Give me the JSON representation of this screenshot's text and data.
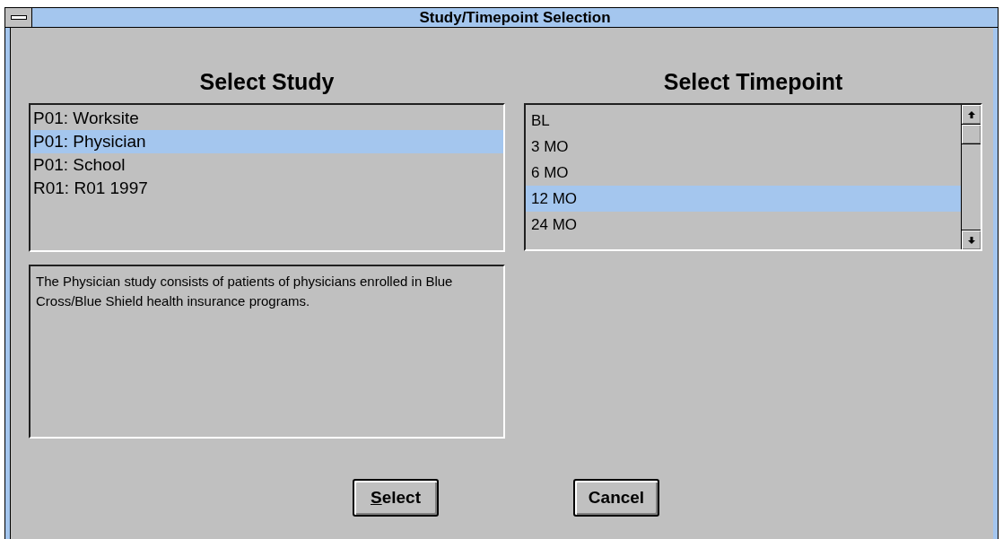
{
  "window": {
    "title": "Study/Timepoint Selection"
  },
  "study": {
    "heading": "Select Study",
    "items": [
      {
        "label": "P01: Worksite",
        "selected": false
      },
      {
        "label": "P01: Physician",
        "selected": true
      },
      {
        "label": "P01: School",
        "selected": false
      },
      {
        "label": "R01: R01 1997",
        "selected": false
      }
    ],
    "description": "The Physician study consists of patients of physicians enrolled in Blue Cross/Blue Shield health insurance programs."
  },
  "timepoint": {
    "heading": "Select Timepoint",
    "items": [
      {
        "label": "BL",
        "selected": false
      },
      {
        "label": "3 MO",
        "selected": false
      },
      {
        "label": "6 MO",
        "selected": false
      },
      {
        "label": "12 MO",
        "selected": true
      },
      {
        "label": "24 MO",
        "selected": false
      }
    ]
  },
  "buttons": [
    {
      "label": "Select",
      "mnemonic_first": true
    },
    {
      "label": "Cancel",
      "mnemonic_first": false
    }
  ]
}
